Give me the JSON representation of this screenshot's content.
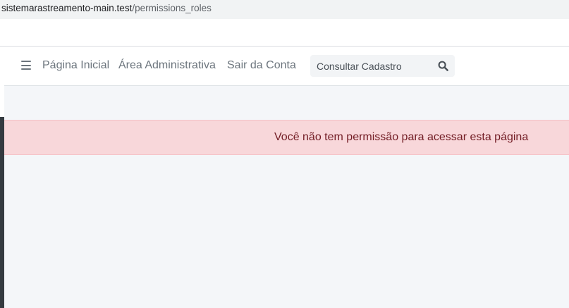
{
  "browser": {
    "url_host": "sistemarastreamento-main.test",
    "url_path": "/permissions_roles"
  },
  "navbar": {
    "menu_icon": "hamburger-menu-icon",
    "links": [
      "Página Inicial",
      "Área Administrativa",
      "Sair da Conta"
    ],
    "search": {
      "placeholder": "Consultar Cadastro",
      "icon": "search-icon"
    }
  },
  "alert": {
    "message": "Você não tem permissão para acessar esta página",
    "background": "#f8d7da",
    "text_color": "#721c24"
  },
  "colors": {
    "page_background": "#f4f6f9",
    "sidebar_dark": "#343a40",
    "nav_text": "#6c757d"
  }
}
